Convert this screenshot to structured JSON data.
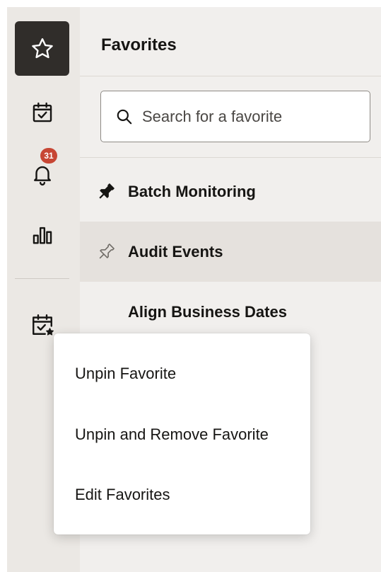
{
  "rail": {
    "items": [
      {
        "icon": "star-icon",
        "active": true
      },
      {
        "icon": "calendar-check-icon",
        "active": false
      },
      {
        "icon": "bell-icon",
        "active": false,
        "badge": "31"
      },
      {
        "icon": "bar-chart-icon",
        "active": false
      },
      {
        "icon": "calendar-star-icon",
        "active": false
      }
    ]
  },
  "panel": {
    "title": "Favorites",
    "search": {
      "placeholder": "Search for a favorite",
      "value": ""
    },
    "favorites": [
      {
        "label": "Batch Monitoring",
        "pinned": true
      },
      {
        "label": "Audit Events",
        "pinned": false,
        "highlighted": true
      },
      {
        "label": "Align Business Dates",
        "pinned": null
      }
    ]
  },
  "context_menu": {
    "items": [
      {
        "label": "Unpin Favorite"
      },
      {
        "label": "Unpin and Remove Favorite"
      },
      {
        "label": "Edit Favorites"
      }
    ]
  },
  "colors": {
    "rail_active_bg": "#302d2a",
    "badge_bg": "#c74634",
    "panel_bg": "#f1efed",
    "highlight_bg": "#e5e1dd"
  }
}
